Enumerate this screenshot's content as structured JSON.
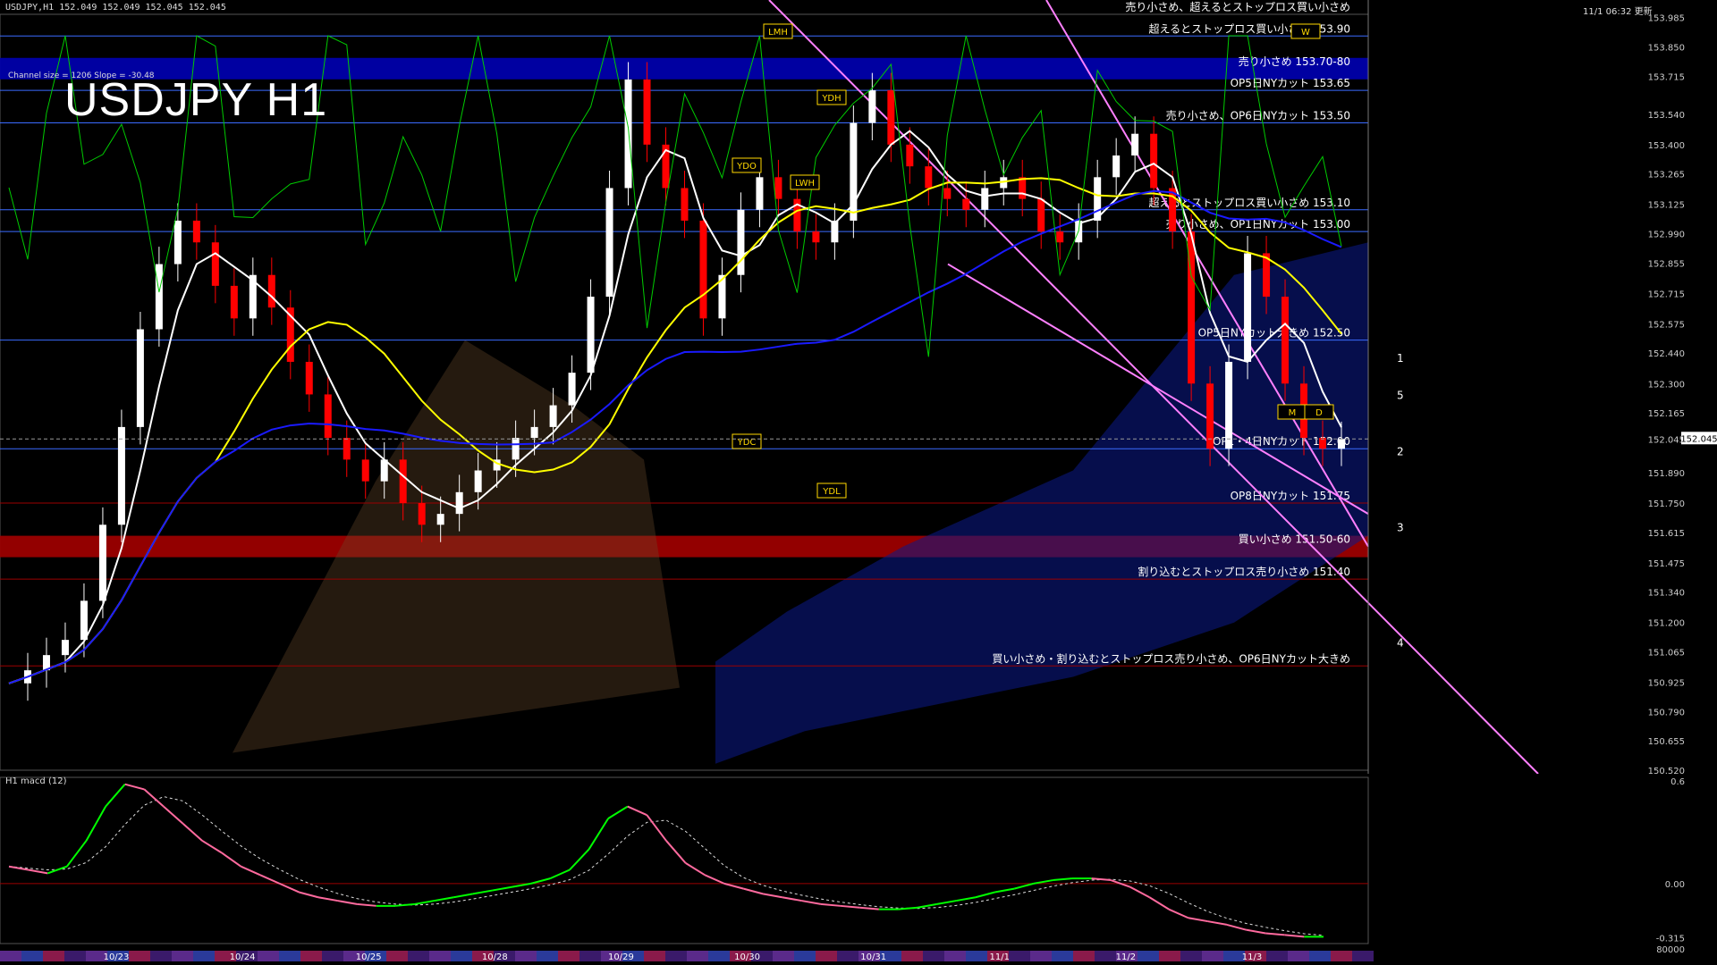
{
  "window": {
    "title_bar": "USDJPY,H1  152.049 152.049 152.045 152.045",
    "chart_title": "USDJPY H1",
    "channel_info": "Channel size = 1206 Slope = -30.48",
    "macd_label": "H1  macd (12)",
    "timestamp": "11/1 06:32 更新"
  },
  "colors": {
    "background": "#000000",
    "bull_candle": "#ffffff",
    "bear_candle": "#ff0000",
    "grid_level": "#3a6bff",
    "sell_zone": "#0000aa",
    "buy_zone": "#9b0000",
    "channel": "#ff80ff",
    "ma_white": "#ffffff",
    "ma_yellow": "#ffff00",
    "ma_blue": "#1a1aff",
    "rsi_green": "#00cc00",
    "macd_up": "#00ff00",
    "macd_down": "#ff6a9e"
  },
  "chart_data": {
    "type": "line",
    "symbol": "USDJPY",
    "timeframe": "H1",
    "ylim": [
      150.52,
      154.0
    ],
    "price_ticks": [
      "153.985",
      "153.850",
      "153.715",
      "153.540",
      "153.400",
      "153.265",
      "153.125",
      "152.990",
      "152.855",
      "152.715",
      "152.575",
      "152.440",
      "152.300",
      "152.165",
      "152.045",
      "151.890",
      "151.750",
      "151.615",
      "151.475",
      "151.340",
      "151.200",
      "151.065",
      "150.925",
      "150.790",
      "150.655",
      "150.520"
    ],
    "current_price": "152.045",
    "date_labels": [
      "10/23",
      "10/24",
      "10/25",
      "10/28",
      "10/29",
      "10/30",
      "10/31",
      "11/1",
      "11/2",
      "11/3"
    ],
    "levels": [
      {
        "price": 153.9,
        "label": "超えるとストップロス買い小さめ 153.90",
        "color": "#3a6bff"
      },
      {
        "price": 153.75,
        "label": "売り小さめ 153.70-80",
        "color": "#0000aa",
        "zone": true
      },
      {
        "price": 153.65,
        "label": "OP5日NYカット 153.65",
        "color": "#3a6bff"
      },
      {
        "price": 153.5,
        "label": "売り小さめ、OP6日NYカット 153.50",
        "color": "#3a6bff"
      },
      {
        "price": 153.1,
        "label": "超えるとストップロス買い小さめ 153.10",
        "color": "#3a6bff"
      },
      {
        "price": 153.0,
        "label": "売り小さめ、OP1日NYカット 153.00",
        "color": "#3a6bff"
      },
      {
        "price": 152.5,
        "label": "OP5日NYカット大きめ 152.50",
        "color": "#3a6bff"
      },
      {
        "price": 152.0,
        "label": "OP1・4日NYカット 152.00",
        "color": "#3a6bff"
      },
      {
        "price": 151.75,
        "label": "OP8日NYカット 151.75",
        "color": "#9b0000"
      },
      {
        "price": 151.55,
        "label": "買い小さめ 151.50-60",
        "color": "#9b0000",
        "zone": true
      },
      {
        "price": 151.4,
        "label": "割り込むとストップロス売り小さめ 151.40",
        "color": "#9b0000"
      },
      {
        "price": 151.0,
        "label": "買い小さめ・割り込むとストップロス売り小さめ、OP6日NYカット大きめ",
        "color": "#9b0000"
      }
    ],
    "top_partial_label": "売り小さめ、超えるとストップロス買い小さめ",
    "scenario_labels": [
      "1",
      "5",
      "2",
      "3",
      "4"
    ],
    "markers": [
      "LMH",
      "YDH",
      "YDO",
      "LWH",
      "YDC",
      "YDL",
      "M",
      "D",
      "W"
    ],
    "macd_ticks": [
      "0.6",
      "0.00",
      "-0.315"
    ],
    "macd_bottom_tick": "80000",
    "series": [
      {
        "name": "close",
        "values": [
          150.92,
          150.98,
          151.05,
          151.12,
          151.3,
          151.65,
          152.1,
          152.55,
          152.85,
          153.05,
          152.95,
          152.75,
          152.6,
          152.8,
          152.65,
          152.4,
          152.25,
          152.05,
          151.95,
          151.85,
          151.95,
          151.75,
          151.65,
          151.7,
          151.8,
          151.9,
          151.95,
          152.05,
          152.1,
          152.2,
          152.35,
          152.7,
          153.2,
          153.7,
          153.4,
          153.2,
          153.05,
          152.6,
          152.8,
          153.1,
          153.25,
          153.15,
          153.0,
          152.95,
          153.05,
          153.5,
          153.65,
          153.4,
          153.3,
          153.2,
          153.15,
          153.1,
          153.2,
          153.25,
          153.15,
          153.0,
          152.95,
          153.05,
          153.25,
          153.35,
          153.45,
          153.2,
          153.0,
          152.3,
          152.0,
          152.4,
          152.9,
          152.7,
          152.3,
          152.05,
          152.0,
          152.045
        ]
      }
    ],
    "macd": [
      0.1,
      0.08,
      0.06,
      0.1,
      0.25,
      0.45,
      0.58,
      0.55,
      0.45,
      0.35,
      0.25,
      0.18,
      0.1,
      0.05,
      0.0,
      -0.05,
      -0.08,
      -0.1,
      -0.12,
      -0.13,
      -0.13,
      -0.12,
      -0.1,
      -0.08,
      -0.06,
      -0.04,
      -0.02,
      0.0,
      0.03,
      0.08,
      0.2,
      0.38,
      0.45,
      0.4,
      0.25,
      0.12,
      0.05,
      0.0,
      -0.03,
      -0.06,
      -0.08,
      -0.1,
      -0.12,
      -0.13,
      -0.14,
      -0.15,
      -0.15,
      -0.14,
      -0.12,
      -0.1,
      -0.08,
      -0.05,
      -0.03,
      0.0,
      0.02,
      0.03,
      0.03,
      0.02,
      -0.02,
      -0.08,
      -0.15,
      -0.2,
      -0.22,
      -0.24,
      -0.27,
      -0.29,
      -0.3,
      -0.31,
      -0.31
    ]
  }
}
